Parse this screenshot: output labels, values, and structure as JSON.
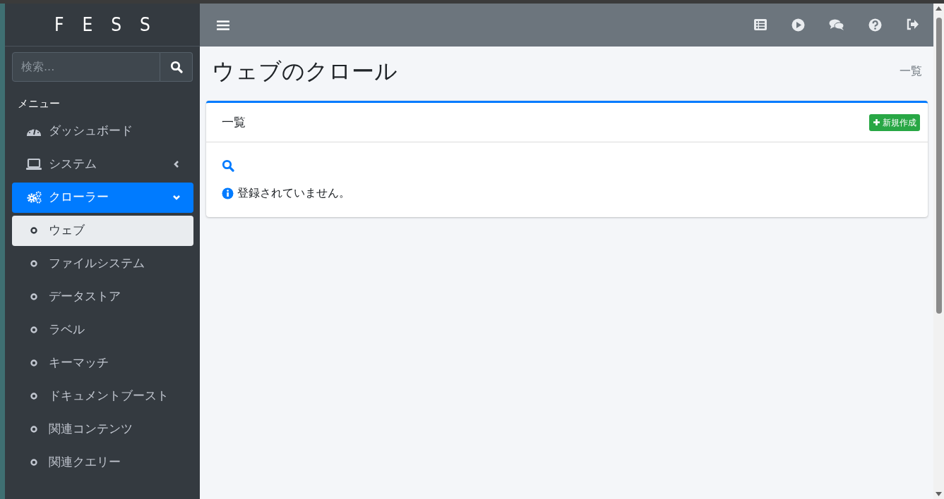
{
  "brand": "FESS",
  "search": {
    "placeholder": "検索..."
  },
  "menu_header": "メニュー",
  "menu": [
    {
      "label": "ダッシュボード",
      "selected": false
    },
    {
      "label": "システム",
      "selected": false,
      "expanded": false
    },
    {
      "label": "クローラー",
      "selected": true,
      "expanded": true,
      "children": [
        {
          "label": "ウェブ",
          "selected": true
        },
        {
          "label": "ファイルシステム",
          "selected": false
        },
        {
          "label": "データストア",
          "selected": false
        },
        {
          "label": "ラベル",
          "selected": false
        },
        {
          "label": "キーマッチ",
          "selected": false
        },
        {
          "label": "ドキュメントブースト",
          "selected": false
        },
        {
          "label": "関連コンテンツ",
          "selected": false
        },
        {
          "label": "関連クエリー",
          "selected": false
        }
      ]
    }
  ],
  "page": {
    "title": "ウェブのクロール",
    "breadcrumb": "一覧"
  },
  "card": {
    "title": "一覧",
    "new_button": "新規作成",
    "message": "登録されていません。"
  }
}
